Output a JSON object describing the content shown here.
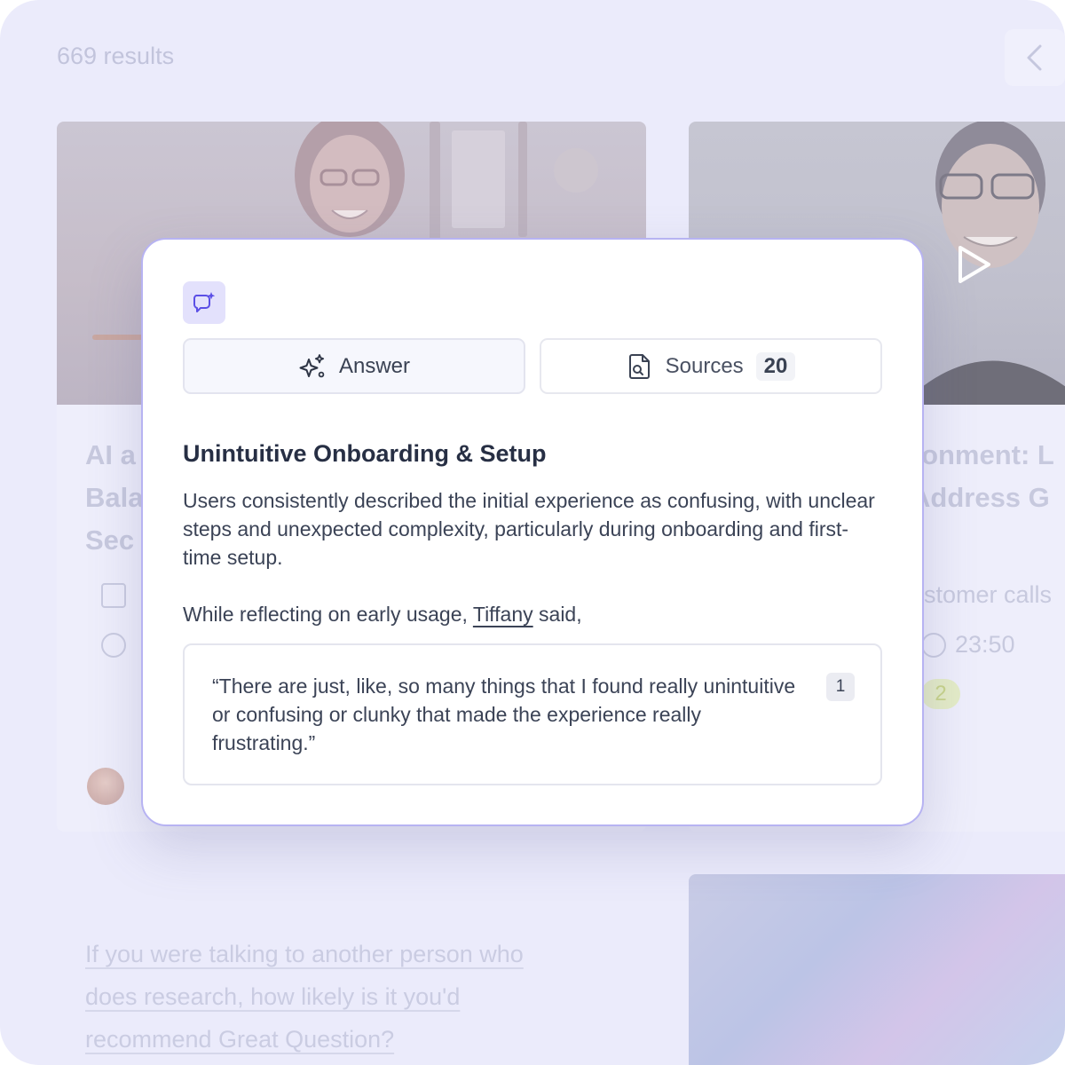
{
  "results": {
    "count_label": "669 results"
  },
  "cards": {
    "left": {
      "title_lines": [
        "AI a",
        "Bala",
        "Sec"
      ]
    },
    "right": {
      "title_lines": [
        "ronment: L",
        "Address G"
      ],
      "meta_label": "stomer calls",
      "duration": "23:50",
      "badge": "2"
    }
  },
  "lower_question": {
    "lines": [
      "If you were talking to another person who",
      "does research, how likely is it you'd",
      "recommend Great Question?"
    ]
  },
  "modal": {
    "tabs": {
      "answer_label": "Answer",
      "sources_label": "Sources",
      "sources_count": "20"
    },
    "heading": "Unintuitive Onboarding & Setup",
    "body": "Users consistently described the initial experience as confusing, with unclear steps and unexpected complexity, particularly during onboarding and first-time setup.",
    "intro_prefix": "While reflecting on early usage,",
    "person": "Tiffany",
    "intro_suffix": "said,",
    "quote": "“There are just, like, so many things that I found really unintuitive or confusing or clunky that made the experience really frustrating.”",
    "citation": "1"
  },
  "colors": {
    "accent": "#6b5cf0",
    "modal_border": "#b7b3f2",
    "backdrop": "#ebebfb"
  }
}
